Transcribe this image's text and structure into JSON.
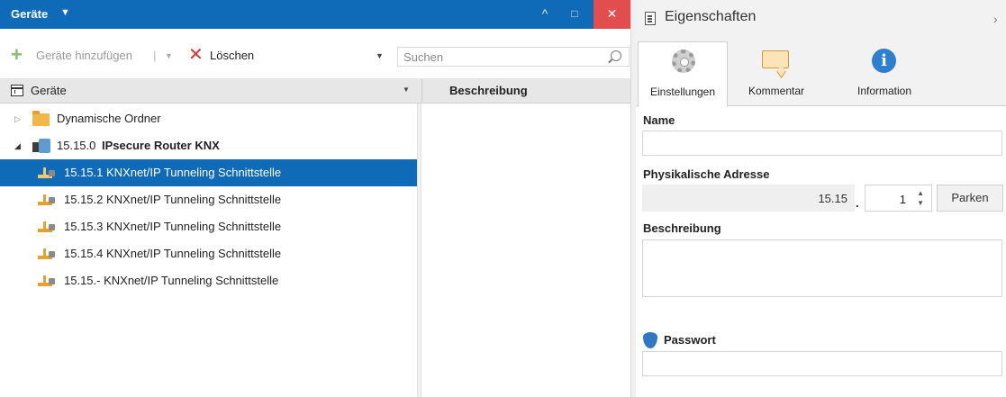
{
  "left": {
    "title": "Geräte",
    "title_caret": "▼",
    "window_up": "^",
    "window_maximize": "□",
    "window_close": "✕"
  },
  "toolbar": {
    "add_label": "Geräte hinzufügen",
    "separator": "|",
    "dropdown_glyph": "▼",
    "delete_label": "Löschen"
  },
  "search": {
    "placeholder": "Suchen",
    "value": ""
  },
  "columns": {
    "devices": "Geräte",
    "description": "Beschreibung"
  },
  "tree": {
    "expand_collapsed": "▷",
    "expand_open": "◢",
    "items": [
      {
        "label": "Dynamische Ordner",
        "type": "folder",
        "expanded": false,
        "selected": false
      },
      {
        "label_bold": "IPsecure Router KNX",
        "prefix": "15.15.0",
        "type": "router",
        "expanded": true,
        "selected": false
      },
      {
        "label": "15.15.1 KNXnet/IP Tunneling Schnittstelle",
        "type": "tunnel",
        "selected": true
      },
      {
        "label": "15.15.2 KNXnet/IP Tunneling Schnittstelle",
        "type": "tunnel",
        "selected": false
      },
      {
        "label": "15.15.3 KNXnet/IP Tunneling Schnittstelle",
        "type": "tunnel",
        "selected": false
      },
      {
        "label": "15.15.4 KNXnet/IP Tunneling Schnittstelle",
        "type": "tunnel",
        "selected": false
      },
      {
        "label": "15.15.- KNXnet/IP Tunneling Schnittstelle",
        "type": "tunnel",
        "selected": false
      }
    ]
  },
  "properties": {
    "title": "Eigenschaften",
    "chevron": "›",
    "tabs": [
      {
        "label": "Einstellungen",
        "icon": "gear-icon",
        "active": true
      },
      {
        "label": "Kommentar",
        "icon": "comment-icon",
        "active": false
      },
      {
        "label": "Information",
        "icon": "info-icon",
        "active": false
      }
    ],
    "info_glyph": "i",
    "name_label": "Name",
    "name_value": "",
    "physical_address_label": "Physikalische Adresse",
    "address_prefix": "15.15",
    "address_dot": ".",
    "address_value": "1",
    "spin_glyph": "▲\n▼",
    "park_label": "Parken",
    "description_label": "Beschreibung",
    "description_value": "",
    "password_label": "Passwort",
    "password_value": ""
  },
  "colors": {
    "accent": "#0f6bb8",
    "close": "#e24e4e",
    "add": "#7dc26a",
    "delete": "#d83434",
    "folder": "#f2b64a",
    "shield": "#2f78c4"
  }
}
